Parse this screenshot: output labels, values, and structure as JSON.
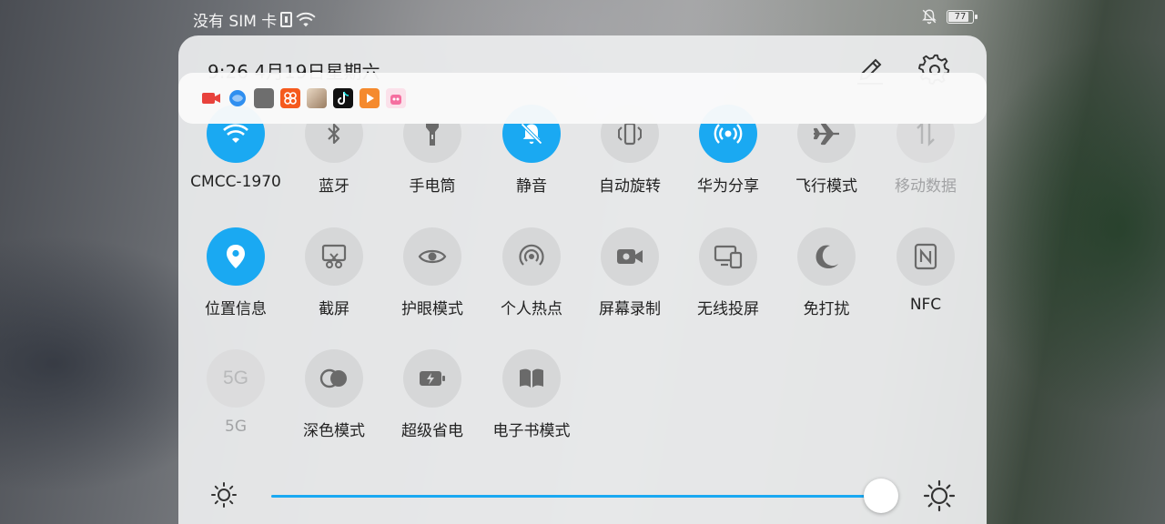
{
  "status_bar": {
    "carrier": "没有 SIM 卡",
    "battery_level": "77",
    "icons": [
      "sim-icon",
      "wifi-icon",
      "mute-icon",
      "battery-icon"
    ]
  },
  "header": {
    "datetime": "9:26 4月19日星期六",
    "edit_icon": "pencil-icon",
    "settings_icon": "gear-icon"
  },
  "notification_apps": [
    {
      "name": "video-camera-app-icon",
      "color": "#e8423c"
    },
    {
      "name": "browser-app-icon",
      "color": "#2f8ff0"
    },
    {
      "name": "gray-app-icon",
      "color": "#6e6e6e"
    },
    {
      "name": "orange-app-icon",
      "color": "#f55a1e"
    },
    {
      "name": "anime-app-icon",
      "color": "#c7a98a"
    },
    {
      "name": "tiktok-app-icon",
      "color": "#111111"
    },
    {
      "name": "play-app-icon",
      "color": "#f58a2e"
    },
    {
      "name": "pink-app-icon",
      "color": "#f56fa0"
    }
  ],
  "tiles": {
    "row1": [
      {
        "label": "CMCC-1970",
        "icon": "wifi-icon",
        "active": true
      },
      {
        "label": "蓝牙",
        "icon": "bluetooth-icon",
        "active": false
      },
      {
        "label": "手电筒",
        "icon": "flashlight-icon",
        "active": false
      },
      {
        "label": "静音",
        "icon": "bell-off-icon",
        "active": true
      },
      {
        "label": "自动旋转",
        "icon": "rotate-icon",
        "active": false
      },
      {
        "label": "华为分享",
        "icon": "share-icon",
        "active": true
      },
      {
        "label": "飞行模式",
        "icon": "airplane-icon",
        "active": false
      },
      {
        "label": "移动数据",
        "icon": "mobile-data-icon",
        "active": false,
        "disabled": true
      }
    ],
    "row2": [
      {
        "label": "位置信息",
        "icon": "location-icon",
        "active": true
      },
      {
        "label": "截屏",
        "icon": "screenshot-icon",
        "active": false
      },
      {
        "label": "护眼模式",
        "icon": "eye-icon",
        "active": false
      },
      {
        "label": "个人热点",
        "icon": "hotspot-icon",
        "active": false
      },
      {
        "label": "屏幕录制",
        "icon": "screen-record-icon",
        "active": false
      },
      {
        "label": "无线投屏",
        "icon": "cast-icon",
        "active": false
      },
      {
        "label": "免打扰",
        "icon": "moon-icon",
        "active": false
      },
      {
        "label": "NFC",
        "icon": "nfc-icon",
        "active": false
      }
    ],
    "row3": [
      {
        "label": "5G",
        "icon": "5g-icon",
        "icon_text": "5G",
        "active": false,
        "disabled": true
      },
      {
        "label": "深色模式",
        "icon": "dark-mode-icon",
        "active": false
      },
      {
        "label": "超级省电",
        "icon": "battery-saver-icon",
        "active": false
      },
      {
        "label": "电子书模式",
        "icon": "ebook-icon",
        "active": false
      }
    ]
  },
  "brightness": {
    "value": 0.98,
    "low_icon": "sun-low-icon",
    "high_icon": "sun-high-icon"
  },
  "colors": {
    "accent": "#1aa9f2",
    "tile_inactive": "#d6d7d8",
    "panel_bg": "#ecedee"
  }
}
